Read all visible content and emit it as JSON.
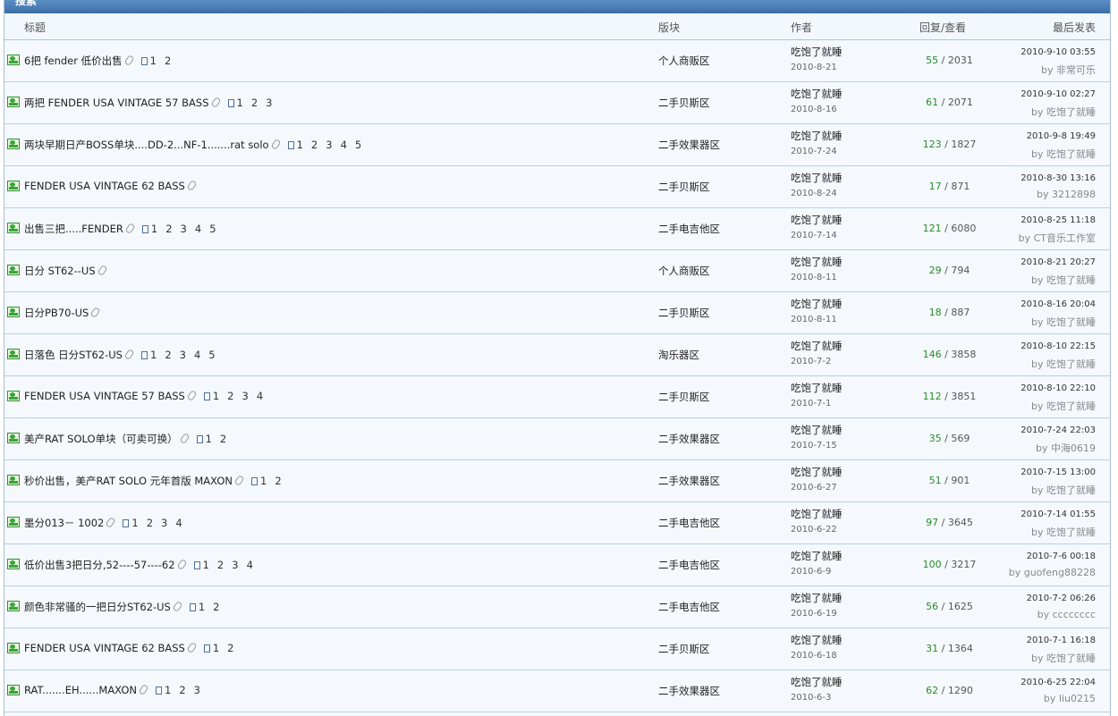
{
  "panel": {
    "title": "搜索"
  },
  "columns": {
    "title": "标题",
    "forum": "版块",
    "author": "作者",
    "replies_views": "回复/查看",
    "last_post": "最后发表"
  },
  "icons": {
    "topic": "topic-image-icon",
    "attachment": "paperclip-icon",
    "pages": "page-icon"
  },
  "colors": {
    "replies": "#2a8a2a",
    "header": "#3c6fa6",
    "row_border": "#b7cfe2"
  },
  "threads": [
    {
      "subject": "6把  fender 低价出售",
      "attachment": true,
      "pages": [
        "1",
        "2"
      ],
      "forum": "个人商贩区",
      "author": "吃饱了就睡",
      "date": "2010-8-21",
      "replies": "55",
      "views": "2031",
      "last_time": "2010-9-10 03:55",
      "last_by": "by 非常可乐"
    },
    {
      "subject": "两把  FENDER USA VINTAGE 57 BASS",
      "attachment": true,
      "pages": [
        "1",
        "2",
        "3"
      ],
      "forum": "二手贝斯区",
      "author": "吃饱了就睡",
      "date": "2010-8-16",
      "replies": "61",
      "views": "2071",
      "last_time": "2010-9-10 02:27",
      "last_by": "by 吃饱了就睡"
    },
    {
      "subject": "两块早期日产BOSS单块....DD-2...NF-1.......rat solo",
      "attachment": true,
      "pages": [
        "1",
        "2",
        "3",
        "4",
        "5"
      ],
      "forum": "二手效果器区",
      "author": "吃饱了就睡",
      "date": "2010-7-24",
      "replies": "123",
      "views": "1827",
      "last_time": "2010-9-8 19:49",
      "last_by": "by 吃饱了就睡"
    },
    {
      "subject": "FENDER USA VINTAGE 62 BASS",
      "attachment": true,
      "pages": [],
      "forum": "二手贝斯区",
      "author": "吃饱了就睡",
      "date": "2010-8-24",
      "replies": "17",
      "views": "871",
      "last_time": "2010-8-30 13:16",
      "last_by": "by 3212898"
    },
    {
      "subject": "出售三把.....FENDER",
      "attachment": true,
      "pages": [
        "1",
        "2",
        "3",
        "4",
        "5"
      ],
      "forum": "二手电吉他区",
      "author": "吃饱了就睡",
      "date": "2010-7-14",
      "replies": "121",
      "views": "6080",
      "last_time": "2010-8-25 11:18",
      "last_by": "by CT音乐工作室"
    },
    {
      "subject": "日分  ST62--US",
      "attachment": true,
      "pages": [],
      "forum": "个人商贩区",
      "author": "吃饱了就睡",
      "date": "2010-8-11",
      "replies": "29",
      "views": "794",
      "last_time": "2010-8-21 20:27",
      "last_by": "by 吃饱了就睡"
    },
    {
      "subject": "日分PB70-US",
      "attachment": true,
      "pages": [],
      "forum": "二手贝斯区",
      "author": "吃饱了就睡",
      "date": "2010-8-11",
      "replies": "18",
      "views": "887",
      "last_time": "2010-8-16 20:04",
      "last_by": "by 吃饱了就睡"
    },
    {
      "subject": "日落色  日分ST62-US",
      "attachment": true,
      "pages": [
        "1",
        "2",
        "3",
        "4",
        "5"
      ],
      "forum": "淘乐器区",
      "author": "吃饱了就睡",
      "date": "2010-7-2",
      "replies": "146",
      "views": "3858",
      "last_time": "2010-8-10 22:15",
      "last_by": "by 吃饱了就睡"
    },
    {
      "subject": "FENDER USA VINTAGE 57 BASS",
      "attachment": true,
      "pages": [
        "1",
        "2",
        "3",
        "4"
      ],
      "forum": "二手贝斯区",
      "author": "吃饱了就睡",
      "date": "2010-7-1",
      "replies": "112",
      "views": "3851",
      "last_time": "2010-8-10 22:10",
      "last_by": "by 吃饱了就睡"
    },
    {
      "subject": "美产RAT SOLO单块（可卖可换）",
      "attachment": true,
      "pages": [
        "1",
        "2"
      ],
      "forum": "二手效果器区",
      "author": "吃饱了就睡",
      "date": "2010-7-15",
      "replies": "35",
      "views": "569",
      "last_time": "2010-7-24 22:03",
      "last_by": "by 中海0619"
    },
    {
      "subject": "秒价出售，美产RAT SOLO 元年首版  MAXON",
      "attachment": true,
      "pages": [
        "1",
        "2"
      ],
      "forum": "二手效果器区",
      "author": "吃饱了就睡",
      "date": "2010-6-27",
      "replies": "51",
      "views": "901",
      "last_time": "2010-7-15 13:00",
      "last_by": "by 吃饱了就睡"
    },
    {
      "subject": "墨分013－ 1002",
      "attachment": true,
      "pages": [
        "1",
        "2",
        "3",
        "4"
      ],
      "forum": "二手电吉他区",
      "author": "吃饱了就睡",
      "date": "2010-6-22",
      "replies": "97",
      "views": "3645",
      "last_time": "2010-7-14 01:55",
      "last_by": "by 吃饱了就睡"
    },
    {
      "subject": "低价出售3把日分,52----57----62",
      "attachment": true,
      "pages": [
        "1",
        "2",
        "3",
        "4"
      ],
      "forum": "二手电吉他区",
      "author": "吃饱了就睡",
      "date": "2010-6-9",
      "replies": "100",
      "views": "3217",
      "last_time": "2010-7-6 00:18",
      "last_by": "by guofeng88228"
    },
    {
      "subject": "颜色非常骚的一把日分ST62-US",
      "attachment": true,
      "pages": [
        "1",
        "2"
      ],
      "forum": "二手电吉他区",
      "author": "吃饱了就睡",
      "date": "2010-6-19",
      "replies": "56",
      "views": "1625",
      "last_time": "2010-7-2 06:26",
      "last_by": "by cccccccc"
    },
    {
      "subject": "FENDER USA VINTAGE 62 BASS",
      "attachment": true,
      "pages": [
        "1",
        "2"
      ],
      "forum": "二手贝斯区",
      "author": "吃饱了就睡",
      "date": "2010-6-18",
      "replies": "31",
      "views": "1364",
      "last_time": "2010-7-1 16:18",
      "last_by": "by 吃饱了就睡"
    },
    {
      "subject": "RAT.......EH......MAXON",
      "attachment": true,
      "pages": [
        "1",
        "2",
        "3"
      ],
      "forum": "二手效果器区",
      "author": "吃饱了就睡",
      "date": "2010-6-3",
      "replies": "62",
      "views": "1290",
      "last_time": "2010-6-25 22:04",
      "last_by": "by liu0215"
    }
  ]
}
